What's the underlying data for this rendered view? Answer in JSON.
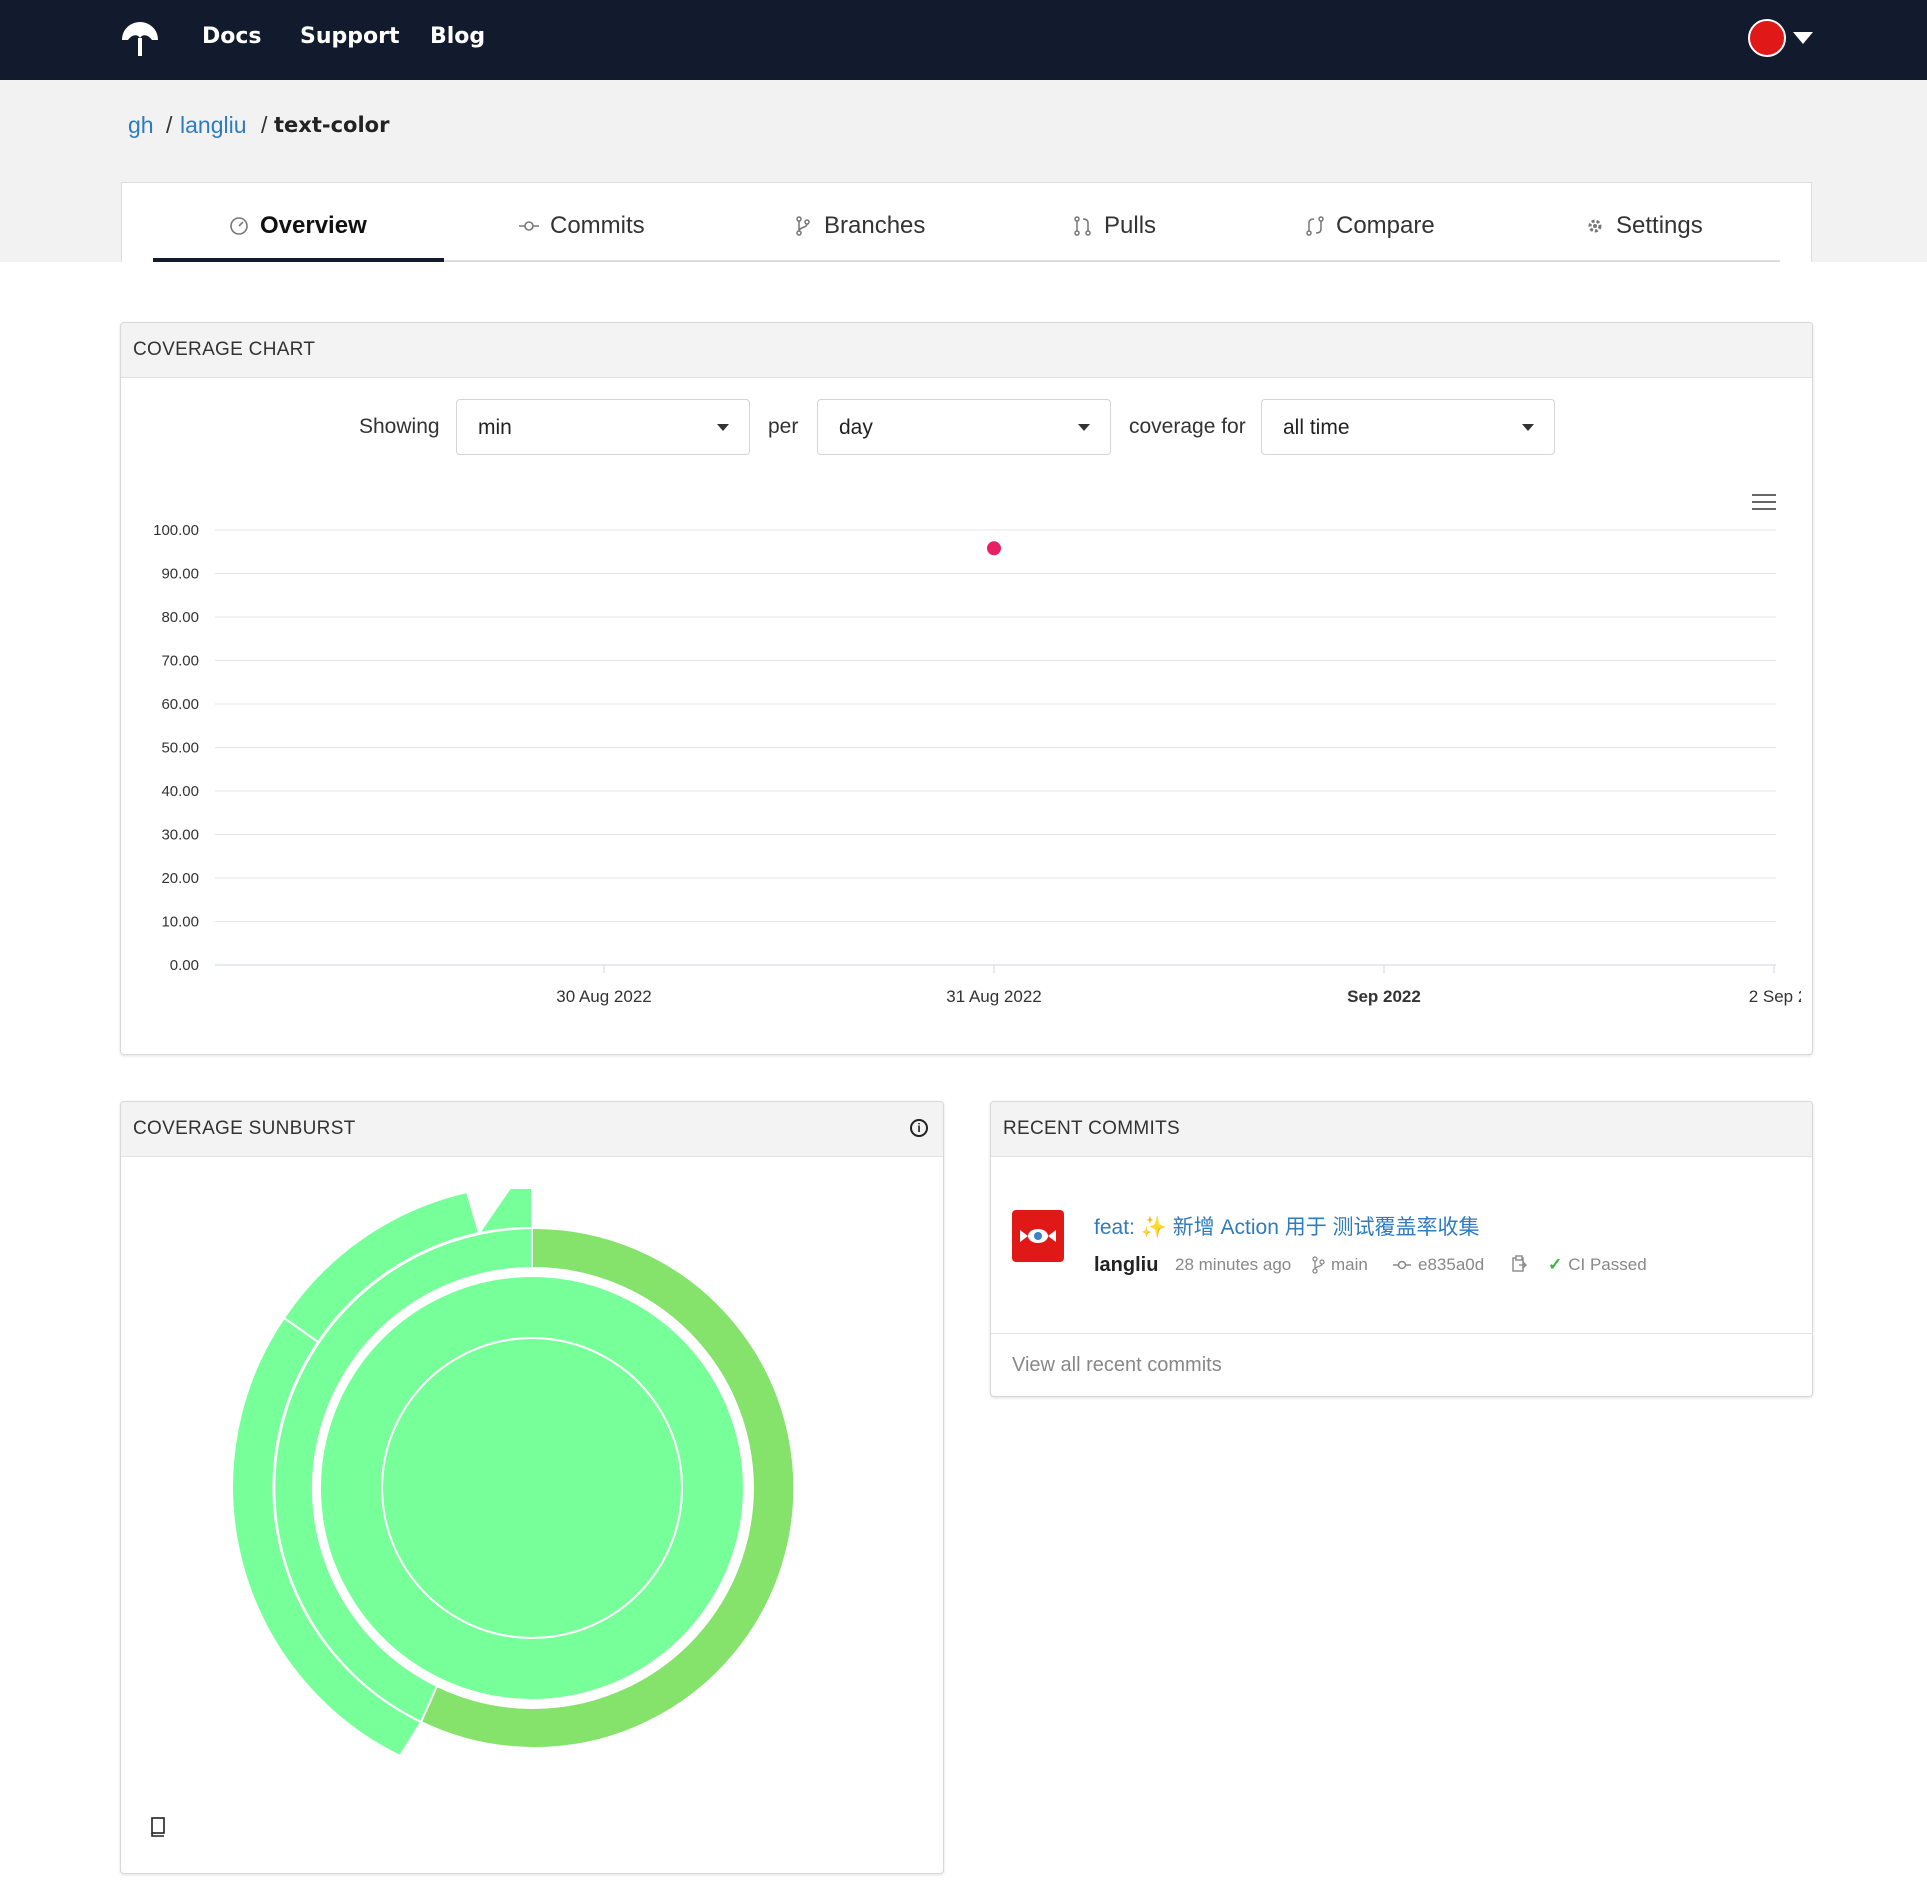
{
  "nav": {
    "links": [
      "Docs",
      "Support",
      "Blog"
    ]
  },
  "breadcrumb": {
    "service": "gh",
    "owner": "langliu",
    "repo": "text-color",
    "sep": "/"
  },
  "tabs": [
    {
      "label": "Overview",
      "icon": "gauge-icon",
      "active": true
    },
    {
      "label": "Commits",
      "icon": "commit-icon",
      "active": false
    },
    {
      "label": "Branches",
      "icon": "branch-icon",
      "active": false
    },
    {
      "label": "Pulls",
      "icon": "pull-request-icon",
      "active": false
    },
    {
      "label": "Compare",
      "icon": "compare-icon",
      "active": false
    },
    {
      "label": "Settings",
      "icon": "gear-icon",
      "active": false
    }
  ],
  "coverage_chart": {
    "title": "COVERAGE CHART",
    "controls": {
      "showing_label": "Showing",
      "showing_value": "min",
      "per_label": "per",
      "per_value": "day",
      "for_label": "coverage for",
      "for_value": "all time"
    }
  },
  "chart_data": {
    "type": "scatter",
    "x": [
      "31 Aug 2022"
    ],
    "y": [
      95.8
    ],
    "xticks": [
      "30 Aug 2022",
      "31 Aug 2022",
      "Sep 2022",
      "2 Sep 2"
    ],
    "yticks": [
      "0.00",
      "10.00",
      "20.00",
      "30.00",
      "40.00",
      "50.00",
      "60.00",
      "70.00",
      "80.00",
      "90.00",
      "100.00"
    ],
    "ylim": [
      0,
      100
    ],
    "grid": true,
    "point_color": "#e91e63"
  },
  "sunburst": {
    "title": "COVERAGE SUNBURST",
    "color_light": "#77ff99",
    "color_mid": "#85e26b"
  },
  "recent_commits": {
    "title": "RECENT COMMITS",
    "items": [
      {
        "message": "feat: ✨ 新增 Action 用于 测试覆盖率收集",
        "author": "langliu",
        "time": "28 minutes ago",
        "branch": "main",
        "sha": "e835a0d",
        "status": "CI Passed"
      }
    ],
    "view_all": "View all recent commits"
  },
  "colors": {
    "nav_bg": "#121b2e",
    "link": "#2f7bbf",
    "ci_passed": "#3ab54a"
  }
}
